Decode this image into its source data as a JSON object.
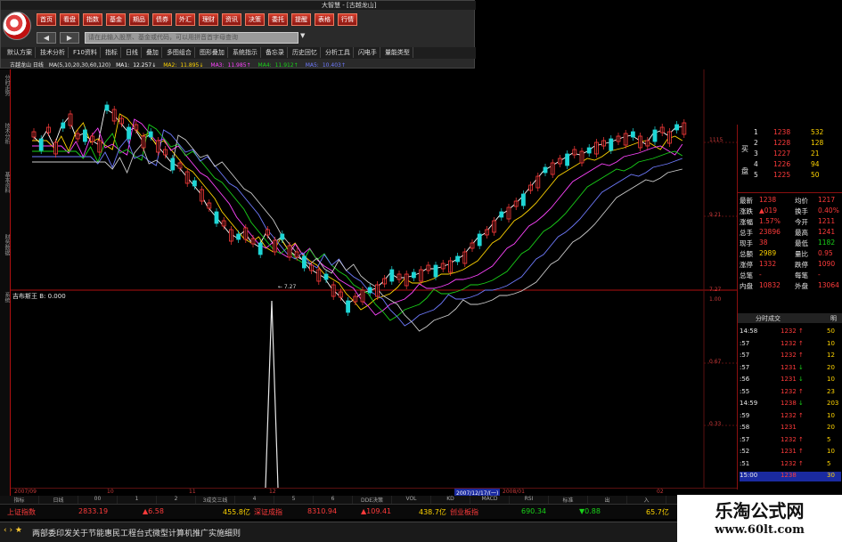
{
  "app": {
    "title": "大智慧 - [古越龙山]"
  },
  "toolbar": {
    "quick_buttons": [
      "首页",
      "看盘",
      "指数",
      "基金",
      "期品",
      "债券",
      "外汇",
      "理财",
      "资讯",
      "决策",
      "委托",
      "提醒",
      "表格",
      "行情"
    ],
    "search_placeholder": "请在此输入股票、基金或代码，可以用拼音首字母查询",
    "back_label": "◀",
    "forward_label": "▶",
    "function_menu": [
      "默认方案",
      "技术分析",
      "F10资料",
      "指标",
      "日线",
      "叠加",
      "多图组合",
      "图形叠加",
      "系统指示",
      "备忘录",
      "历史回忆",
      "分析工具",
      "闪电手",
      "量能类型"
    ]
  },
  "ma_header": {
    "stock": "古越龙山 日线",
    "ma_params": "MA(5,10,20,30,60,120)",
    "items": [
      {
        "label": "MA1:",
        "value": "12.257↓",
        "color": "#ffffff"
      },
      {
        "label": "MA2:",
        "value": "11.895↓",
        "color": "#ffd400"
      },
      {
        "label": "MA3:",
        "value": "11.985↑",
        "color": "#ff44ff"
      },
      {
        "label": "MA4:",
        "value": "11.912↑",
        "color": "#19d219"
      },
      {
        "label": "MA5:",
        "value": "10.403↑",
        "color": "#6f7bff"
      }
    ]
  },
  "left_tabs": [
    "分时走势",
    "技术分析",
    "基本资料",
    "财务数据",
    "系统"
  ],
  "indicator": {
    "label": "吉布斯王 B: 0.000"
  },
  "price_axis": {
    "ticks": [
      "1115",
      "9.21",
      "7.27",
      "1.00",
      "0.67",
      "0.33"
    ]
  },
  "date_axis": {
    "ticks": [
      "2007/09",
      "10",
      "11",
      "12",
      "2008/01",
      "02"
    ],
    "cursor_date": "2007/12/17/(一)"
  },
  "page_tabs": [
    "指标",
    "日线",
    "00",
    "1",
    "2",
    "3成交三线",
    "4",
    "5",
    "6",
    "DDE决策",
    "VOL",
    "KD",
    "MACD",
    "RSI",
    "标准",
    "出",
    "入",
    "分钟",
    "资金",
    "精选"
  ],
  "index_bar": {
    "sh_name": "上证指数",
    "sh_value": "2833.19",
    "sh_change": "▲6.58",
    "sh_amount": "455.8亿",
    "sz_name": "深证成指",
    "sz_value": "8310.94",
    "sz_change": "▲109.41",
    "sz_amount": "438.7亿",
    "cy_name": "创业板指",
    "cy_value": "690.34",
    "cy_change": "▼0.88",
    "cy_amount": "65.7亿"
  },
  "news": {
    "icons": "‹ › ★",
    "headline": "两部委印发关于节能惠民工程台式微型计算机推广实施细则"
  },
  "quote_panel": {
    "side_buy": "买",
    "side_sell": "盘",
    "order_book": [
      {
        "level": "1",
        "price": "1238",
        "volume": "532"
      },
      {
        "level": "2",
        "price": "1228",
        "volume": "128"
      },
      {
        "level": "3",
        "price": "1227",
        "volume": "21"
      },
      {
        "level": "4",
        "price": "1226",
        "volume": "94"
      },
      {
        "level": "5",
        "price": "1225",
        "volume": "50"
      }
    ],
    "stats": [
      {
        "k1": "最新",
        "v1": "1238",
        "k2": "均价",
        "v2": "1217"
      },
      {
        "k1": "涨跌",
        "v1": "▲019",
        "k2": "换手",
        "v2": "0.40%"
      },
      {
        "k1": "涨幅",
        "v1": "1.57%",
        "k2": "今开",
        "v2": "1211"
      },
      {
        "k1": "总手",
        "v1": "23896",
        "k2": "最高",
        "v2": "1241"
      },
      {
        "k1": "现手",
        "v1": "38",
        "k2": "最低",
        "v2": "1182"
      },
      {
        "k1": "总额",
        "v1": "2989",
        "k2": "量比",
        "v2": "0.95"
      },
      {
        "k1": "涨停",
        "v1": "1332",
        "k2": "跌停",
        "v2": "1090"
      },
      {
        "k1": "总笔",
        "v1": "-",
        "k2": "每笔",
        "v2": "-"
      },
      {
        "k1": "内盘",
        "v1": "10832",
        "k2": "外盘",
        "v2": "13064"
      }
    ],
    "trade_header": {
      "left": "分时成交",
      "right": "明"
    },
    "trades": [
      {
        "time": "14:58",
        "price": "1232",
        "dir": "↑",
        "vol": "50"
      },
      {
        "time": ":57",
        "price": "1232",
        "dir": "↑",
        "vol": "10"
      },
      {
        "time": ":57",
        "price": "1232",
        "dir": "↑",
        "vol": "12"
      },
      {
        "time": ":57",
        "price": "1231",
        "dir": "↓",
        "vol": "20"
      },
      {
        "time": ":56",
        "price": "1231",
        "dir": "↓",
        "vol": "10"
      },
      {
        "time": ":55",
        "price": "1232",
        "dir": "↑",
        "vol": "23"
      },
      {
        "time": "14:59",
        "price": "1238",
        "dir": "↓",
        "vol": "203"
      },
      {
        "time": ":59",
        "price": "1232",
        "dir": "↑",
        "vol": "10"
      },
      {
        "time": ":58",
        "price": "1231",
        "dir": "",
        "vol": "20"
      },
      {
        "time": ":57",
        "price": "1232",
        "dir": "↑",
        "vol": "5"
      },
      {
        "time": ":52",
        "price": "1231",
        "dir": "↑",
        "vol": "10"
      },
      {
        "time": ":51",
        "price": "1232",
        "dir": "↑",
        "vol": "5"
      },
      {
        "time": "15:00",
        "price": "1238",
        "dir": "",
        "vol": "30"
      }
    ]
  },
  "watermark": {
    "title": "乐淘公式网",
    "url": "www.60lt.com"
  },
  "colors": {
    "up": "#ff3b3b",
    "down": "#19d219",
    "axis": "#8a1010",
    "bg": "#000000"
  }
}
